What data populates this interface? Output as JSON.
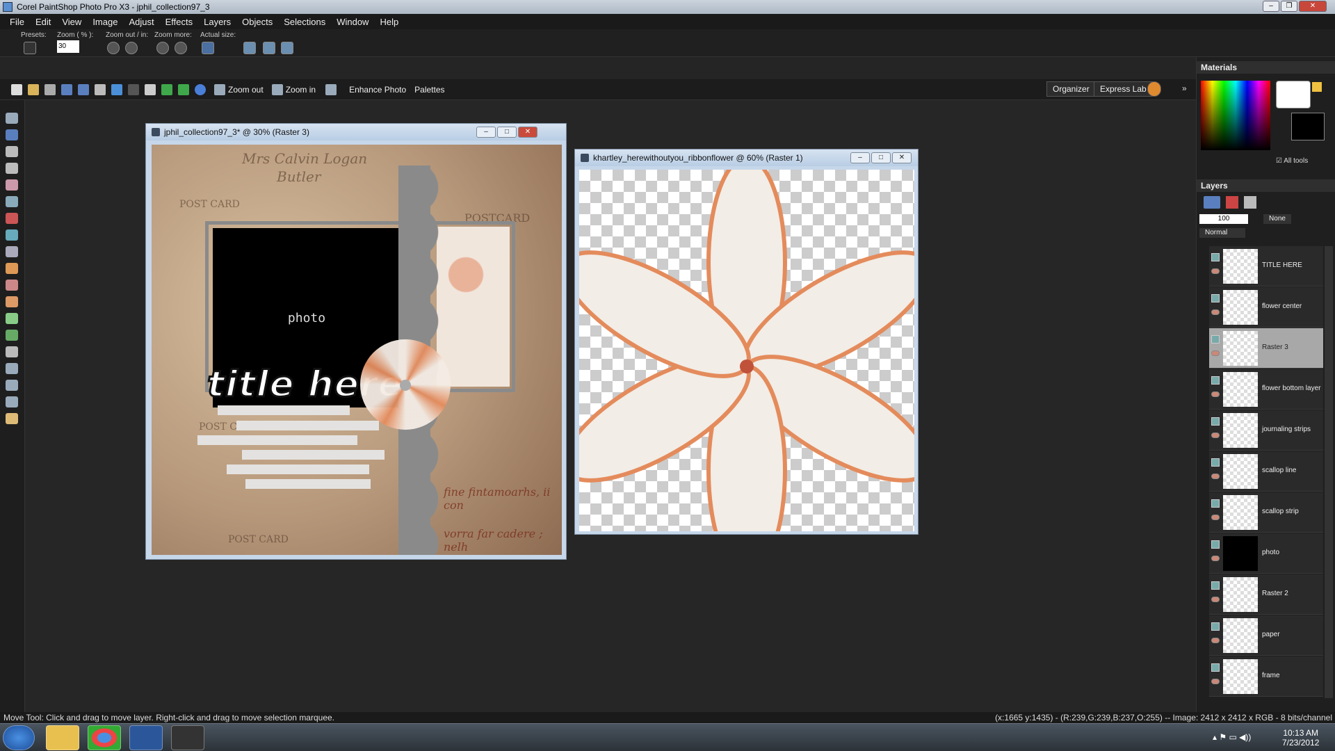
{
  "window": {
    "title": "Corel PaintShop Photo Pro X3 - jphil_collection97_3"
  },
  "menu": [
    "File",
    "Edit",
    "View",
    "Image",
    "Adjust",
    "Effects",
    "Layers",
    "Objects",
    "Selections",
    "Window",
    "Help"
  ],
  "options": {
    "presets": "Presets:",
    "zoom_label": "Zoom ( % ):",
    "zoom_value": "30",
    "zoom_out_in": "Zoom out / in:",
    "zoom_more": "Zoom more:",
    "actual_size": "Actual size:"
  },
  "toolbar": {
    "zoom_out": "Zoom out",
    "zoom_in": "Zoom in",
    "enhance_photo": "Enhance Photo",
    "palettes": "Palettes",
    "organizer": "Organizer",
    "express_lab": "Express Lab"
  },
  "doc1": {
    "title": "jphil_collection97_3* @  30% (Raster 3)",
    "photo_label": "photo",
    "title_art": "title here",
    "paper_text": [
      "Mrs Calvin Logan",
      "Butler",
      "POST CARD",
      "POSTCARD",
      "POST CARD",
      "POST CARD",
      "fine fintamoarhs, ii con",
      "vorra far cadere ; nelh"
    ]
  },
  "doc2": {
    "title": "khartley_herewithoutyou_ribbonflower @  60% (Raster 1)"
  },
  "materials": {
    "title": "Materials",
    "all_tools": "All tools"
  },
  "layers": {
    "title": "Layers",
    "opacity": "100",
    "blend_mode": "Normal",
    "mask": "None",
    "items": [
      {
        "name": "TITLE HERE"
      },
      {
        "name": "flower center"
      },
      {
        "name": "Raster 3",
        "selected": true
      },
      {
        "name": "flower bottom layer"
      },
      {
        "name": "journaling strips"
      },
      {
        "name": "scallop line"
      },
      {
        "name": "scallop strip"
      },
      {
        "name": "photo"
      },
      {
        "name": "Raster 2"
      },
      {
        "name": "paper"
      },
      {
        "name": "frame"
      }
    ]
  },
  "status": {
    "left": "Move Tool: Click and drag to move layer. Right-click and drag to move selection marquee.",
    "right": "(x:1665 y:1435) - (R:239,G:239,B:237,O:255) -- Image:  2412 x 2412 x RGB - 8 bits/channel"
  },
  "taskbar": {
    "time": "10:13 AM",
    "date": "7/23/2012"
  }
}
